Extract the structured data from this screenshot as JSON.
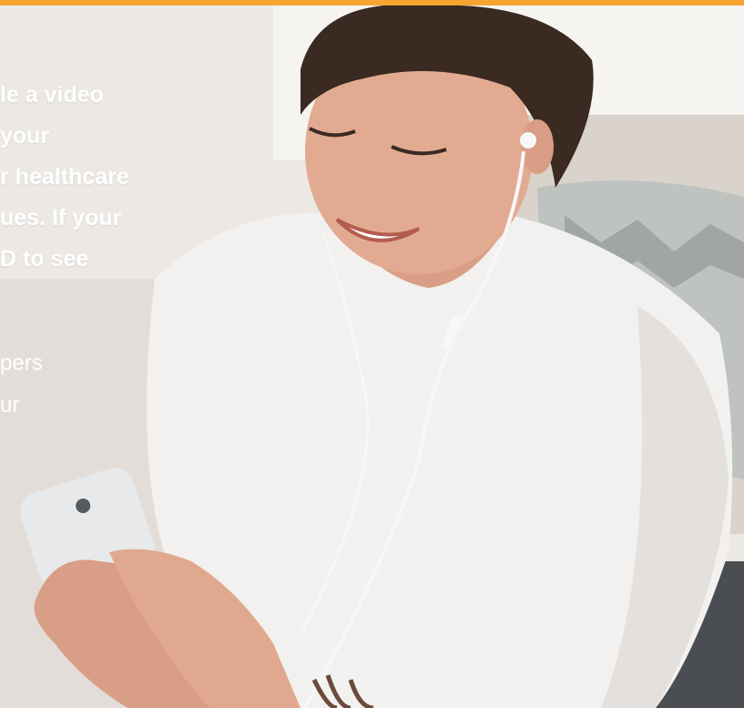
{
  "colors": {
    "accent": "#f7a531",
    "headline_text": "#ffffff",
    "wall": "#ece8e4",
    "sofa": "#d8d2cb",
    "shirt": "#f3f1ef",
    "skin": "#e0a98f",
    "hair": "#3a2a22",
    "phone": "#e8e9ea"
  },
  "hero": {
    "headline_lines": [
      "le a video",
      "your",
      "r healthcare",
      "ues. If your",
      "D to see"
    ],
    "subcopy_lines": [
      "pers",
      "ur"
    ]
  },
  "image": {
    "subject": "smiling-woman-with-earphones-using-phone"
  }
}
